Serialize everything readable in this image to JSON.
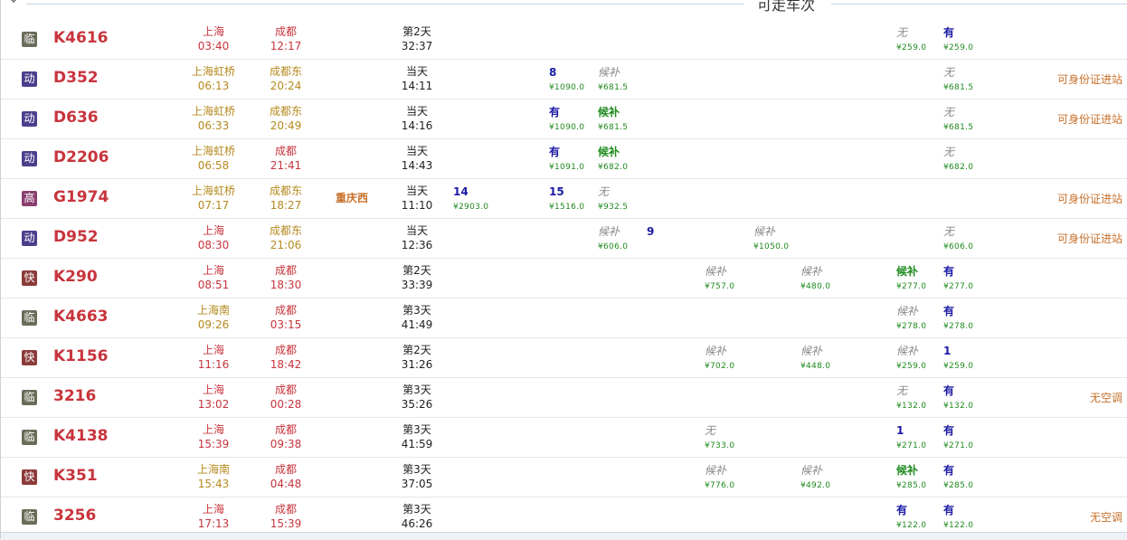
{
  "header": {
    "title": "可走车次"
  },
  "colors": {
    "accent": "#c8343c",
    "seat_available": "#1a1aa6",
    "waitlist": "#1f8a1f",
    "price": "#1f8a1f",
    "note": "#c8702a"
  },
  "trains": [
    {
      "type": "临",
      "type_color": "#6b6b5a",
      "no": "K4616",
      "from": "上海",
      "from_time": "03:40",
      "to": "成都",
      "to_time": "12:17",
      "from_color": "red",
      "to_color": "red",
      "via": "",
      "day": "第2天",
      "duration": "32:37",
      "seats": [
        {
          "col": 9,
          "val": "无",
          "kind": "gray",
          "price": "¥259.0"
        },
        {
          "col": 10,
          "val": "有",
          "kind": "blue",
          "price": "¥259.0"
        }
      ],
      "note": ""
    },
    {
      "type": "动",
      "type_color": "#4b3f8c",
      "no": "D352",
      "from": "上海虹桥",
      "from_time": "06:13",
      "to": "成都东",
      "to_time": "20:24",
      "from_color": "olive",
      "to_color": "olive",
      "via": "",
      "day": "当天",
      "duration": "14:11",
      "seats": [
        {
          "col": 2,
          "val": "8",
          "kind": "blue",
          "price": "¥1090.0"
        },
        {
          "col": 3,
          "val": "候补",
          "kind": "gray",
          "price": "¥681.5"
        },
        {
          "col": 10,
          "val": "无",
          "kind": "gray",
          "price": "¥681.5"
        }
      ],
      "note": "可身份证进站"
    },
    {
      "type": "动",
      "type_color": "#4b3f8c",
      "no": "D636",
      "from": "上海虹桥",
      "from_time": "06:33",
      "to": "成都东",
      "to_time": "20:49",
      "from_color": "olive",
      "to_color": "olive",
      "via": "",
      "day": "当天",
      "duration": "14:16",
      "seats": [
        {
          "col": 2,
          "val": "有",
          "kind": "blue",
          "price": "¥1090.0"
        },
        {
          "col": 3,
          "val": "候补",
          "kind": "green",
          "price": "¥681.5"
        },
        {
          "col": 10,
          "val": "无",
          "kind": "gray",
          "price": "¥681.5"
        }
      ],
      "note": "可身份证进站"
    },
    {
      "type": "动",
      "type_color": "#4b3f8c",
      "no": "D2206",
      "from": "上海虹桥",
      "from_time": "06:58",
      "to": "成都",
      "to_time": "21:41",
      "from_color": "olive",
      "to_color": "red",
      "via": "",
      "day": "当天",
      "duration": "14:43",
      "seats": [
        {
          "col": 2,
          "val": "有",
          "kind": "blue",
          "price": "¥1091.0"
        },
        {
          "col": 3,
          "val": "候补",
          "kind": "green",
          "price": "¥682.0"
        },
        {
          "col": 10,
          "val": "无",
          "kind": "gray",
          "price": "¥682.0"
        }
      ],
      "note": ""
    },
    {
      "type": "高",
      "type_color": "#8a3f6e",
      "no": "G1974",
      "from": "上海虹桥",
      "from_time": "07:17",
      "to": "成都东",
      "to_time": "18:27",
      "from_color": "olive",
      "to_color": "olive",
      "via": "重庆西",
      "day": "当天",
      "duration": "11:10",
      "seats": [
        {
          "col": 0,
          "val": "14",
          "kind": "blue",
          "price": "¥2903.0"
        },
        {
          "col": 2,
          "val": "15",
          "kind": "blue",
          "price": "¥1516.0"
        },
        {
          "col": 3,
          "val": "无",
          "kind": "gray",
          "price": "¥932.5"
        }
      ],
      "note": "可身份证进站"
    },
    {
      "type": "动",
      "type_color": "#4b3f8c",
      "no": "D952",
      "from": "上海",
      "from_time": "08:30",
      "to": "成都东",
      "to_time": "21:06",
      "from_color": "red",
      "to_color": "olive",
      "via": "",
      "day": "当天",
      "duration": "12:36",
      "seats": [
        {
          "col": 3,
          "val": "候补",
          "kind": "gray",
          "price": "¥606.0"
        },
        {
          "col": 4,
          "val": "9",
          "kind": "blue",
          "price": ""
        },
        {
          "col": 6,
          "val": "候补",
          "kind": "gray",
          "price": "¥1050.0"
        },
        {
          "col": 10,
          "val": "无",
          "kind": "gray",
          "price": "¥606.0"
        }
      ],
      "note": "可身份证进站"
    },
    {
      "type": "快",
      "type_color": "#8c3a3a",
      "no": "K290",
      "from": "上海",
      "from_time": "08:51",
      "to": "成都",
      "to_time": "18:30",
      "from_color": "red",
      "to_color": "red",
      "via": "",
      "day": "第2天",
      "duration": "33:39",
      "seats": [
        {
          "col": 5,
          "val": "候补",
          "kind": "gray",
          "price": "¥757.0"
        },
        {
          "col": 7,
          "val": "候补",
          "kind": "gray",
          "price": "¥480.0"
        },
        {
          "col": 9,
          "val": "候补",
          "kind": "green",
          "price": "¥277.0"
        },
        {
          "col": 10,
          "val": "有",
          "kind": "blue",
          "price": "¥277.0"
        }
      ],
      "note": ""
    },
    {
      "type": "临",
      "type_color": "#6b6b5a",
      "no": "K4663",
      "from": "上海南",
      "from_time": "09:26",
      "to": "成都",
      "to_time": "03:15",
      "from_color": "olive",
      "to_color": "red",
      "via": "",
      "day": "第3天",
      "duration": "41:49",
      "seats": [
        {
          "col": 9,
          "val": "候补",
          "kind": "gray",
          "price": "¥278.0"
        },
        {
          "col": 10,
          "val": "有",
          "kind": "blue",
          "price": "¥278.0"
        }
      ],
      "note": ""
    },
    {
      "type": "快",
      "type_color": "#8c3a3a",
      "no": "K1156",
      "from": "上海",
      "from_time": "11:16",
      "to": "成都",
      "to_time": "18:42",
      "from_color": "red",
      "to_color": "red",
      "via": "",
      "day": "第2天",
      "duration": "31:26",
      "seats": [
        {
          "col": 5,
          "val": "候补",
          "kind": "gray",
          "price": "¥702.0"
        },
        {
          "col": 7,
          "val": "候补",
          "kind": "gray",
          "price": "¥448.0"
        },
        {
          "col": 9,
          "val": "候补",
          "kind": "gray",
          "price": "¥259.0"
        },
        {
          "col": 10,
          "val": "1",
          "kind": "blue",
          "price": "¥259.0"
        }
      ],
      "note": ""
    },
    {
      "type": "临",
      "type_color": "#6b6b5a",
      "no": "3216",
      "from": "上海",
      "from_time": "13:02",
      "to": "成都",
      "to_time": "00:28",
      "from_color": "red",
      "to_color": "red",
      "via": "",
      "day": "第3天",
      "duration": "35:26",
      "seats": [
        {
          "col": 9,
          "val": "无",
          "kind": "gray",
          "price": "¥132.0"
        },
        {
          "col": 10,
          "val": "有",
          "kind": "blue",
          "price": "¥132.0"
        }
      ],
      "note": "无空调"
    },
    {
      "type": "临",
      "type_color": "#6b6b5a",
      "no": "K4138",
      "from": "上海",
      "from_time": "15:39",
      "to": "成都",
      "to_time": "09:38",
      "from_color": "red",
      "to_color": "red",
      "via": "",
      "day": "第3天",
      "duration": "41:59",
      "seats": [
        {
          "col": 5,
          "val": "无",
          "kind": "gray",
          "price": "¥733.0"
        },
        {
          "col": 9,
          "val": "1",
          "kind": "blue",
          "price": "¥271.0"
        },
        {
          "col": 10,
          "val": "有",
          "kind": "blue",
          "price": "¥271.0"
        }
      ],
      "note": ""
    },
    {
      "type": "快",
      "type_color": "#8c3a3a",
      "no": "K351",
      "from": "上海南",
      "from_time": "15:43",
      "to": "成都",
      "to_time": "04:48",
      "from_color": "olive",
      "to_color": "red",
      "via": "",
      "day": "第3天",
      "duration": "37:05",
      "seats": [
        {
          "col": 5,
          "val": "候补",
          "kind": "gray",
          "price": "¥776.0"
        },
        {
          "col": 7,
          "val": "候补",
          "kind": "gray",
          "price": "¥492.0"
        },
        {
          "col": 9,
          "val": "候补",
          "kind": "green",
          "price": "¥285.0"
        },
        {
          "col": 10,
          "val": "有",
          "kind": "blue",
          "price": "¥285.0"
        }
      ],
      "note": ""
    },
    {
      "type": "临",
      "type_color": "#6b6b5a",
      "no": "3256",
      "from": "上海",
      "from_time": "17:13",
      "to": "成都",
      "to_time": "15:39",
      "from_color": "red",
      "to_color": "red",
      "via": "",
      "day": "第3天",
      "duration": "46:26",
      "seats": [
        {
          "col": 9,
          "val": "有",
          "kind": "blue",
          "price": "¥122.0"
        },
        {
          "col": 10,
          "val": "有",
          "kind": "blue",
          "price": "¥122.0"
        }
      ],
      "note": "无空调"
    }
  ]
}
